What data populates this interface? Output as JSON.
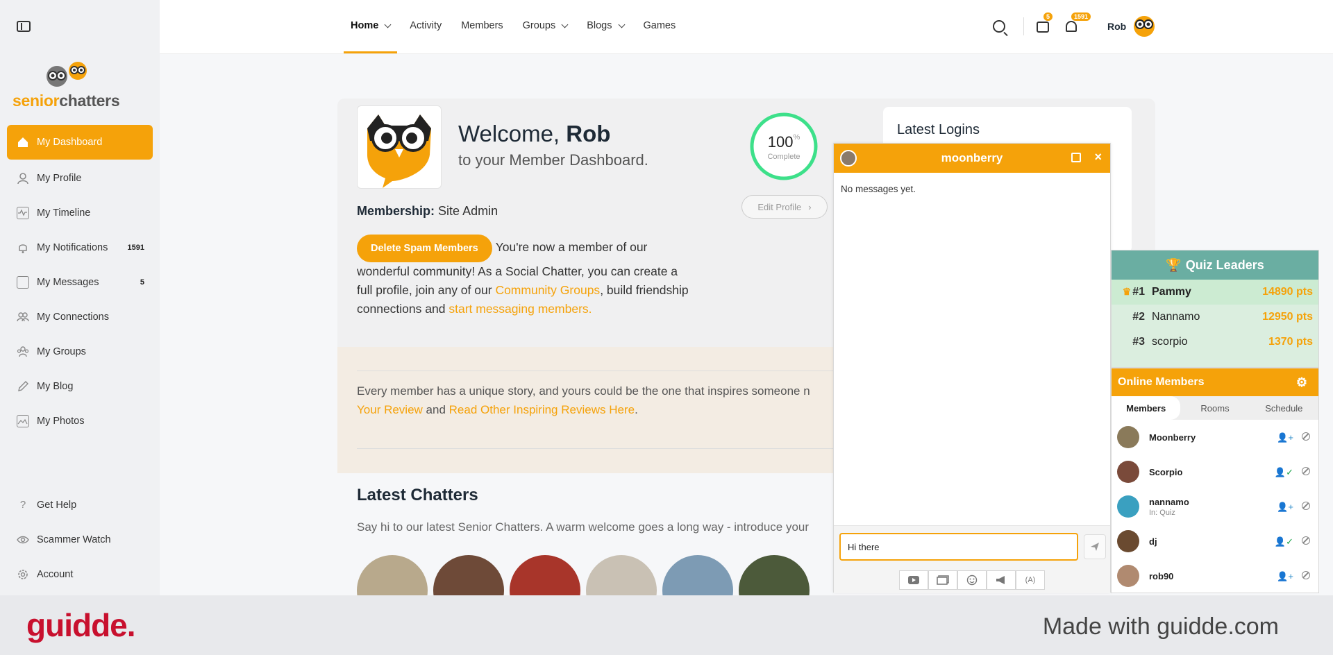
{
  "sidebar": {
    "logo": {
      "senior": "senior",
      "chatters": "chatters"
    },
    "items": [
      {
        "label": "My Dashboard",
        "icon": "home-icon",
        "active": true
      },
      {
        "label": "My Profile",
        "icon": "user-icon"
      },
      {
        "label": "My Timeline",
        "icon": "activity-icon"
      },
      {
        "label": "My Notifications",
        "icon": "bell-icon",
        "badge": "1591"
      },
      {
        "label": "My Messages",
        "icon": "inbox-icon",
        "badge": "5"
      },
      {
        "label": "My Connections",
        "icon": "users-icon"
      },
      {
        "label": "My Groups",
        "icon": "groups-icon"
      },
      {
        "label": "My Blog",
        "icon": "pencil-icon"
      },
      {
        "label": "My Photos",
        "icon": "photos-icon"
      }
    ],
    "bottom": [
      {
        "label": "Get Help",
        "icon": "question-icon"
      },
      {
        "label": "Scammer Watch",
        "icon": "eye-icon"
      },
      {
        "label": "Account",
        "icon": "gear-icon"
      }
    ]
  },
  "topnav": {
    "menu": [
      {
        "label": "Home",
        "active": true,
        "dropdown": true
      },
      {
        "label": "Activity"
      },
      {
        "label": "Members"
      },
      {
        "label": "Groups",
        "dropdown": true
      },
      {
        "label": "Blogs",
        "dropdown": true
      },
      {
        "label": "Games"
      }
    ],
    "messages_badge": "5",
    "notifications_badge": "1591",
    "user_name": "Rob"
  },
  "dashboard": {
    "welcome_prefix": "Welcome,",
    "welcome_name": "Rob",
    "subtitle": "to your Member Dashboard.",
    "progress_value": "100",
    "progress_unit": "%",
    "progress_label": "Complete",
    "edit_profile": "Edit Profile",
    "membership_label": "Membership:",
    "membership_value": "Site Admin",
    "spam_button": "Delete Spam Members",
    "intro_1": "You're now a member of our wonderful community! As a Social Chatter, you can create a full profile, join any of our",
    "intro_link_1": "Community Groups",
    "intro_2": ", build friendship connections and",
    "intro_link_2": "start messaging members.",
    "review_text": "Every member has a unique story, and yours could be the one that inspires someone n",
    "review_link_1": "Your Review",
    "review_and": "and",
    "review_link_2": "Read Other Inspiring Reviews Here",
    "latest_chatters_title": "Latest Chatters",
    "latest_chatters_sub": "Say hi to our latest Senior Chatters. A warm welcome goes a long way - introduce your",
    "latest_logins_title": "Latest Logins"
  },
  "chat": {
    "title": "moonberry",
    "empty": "No messages yet.",
    "input_value": "Hi there"
  },
  "quiz": {
    "title": "Quiz Leaders",
    "leaders": [
      {
        "rank": "#1",
        "name": "Pammy",
        "points": "14890 pts"
      },
      {
        "rank": "#2",
        "name": "Nannamo",
        "points": "12950 pts"
      },
      {
        "rank": "#3",
        "name": "scorpio",
        "points": "1370 pts"
      }
    ]
  },
  "online": {
    "title": "Online Members",
    "tabs": [
      "Members",
      "Rooms",
      "Schedule"
    ],
    "members": [
      {
        "name": "Moonberry",
        "sub": ""
      },
      {
        "name": "Scorpio",
        "sub": ""
      },
      {
        "name": "nannamo",
        "sub": "In: Quiz"
      },
      {
        "name": "dj",
        "sub": ""
      },
      {
        "name": "rob90",
        "sub": ""
      }
    ]
  },
  "footer": {
    "logo": "guidde.",
    "made_with": "Made with guidde.com"
  },
  "colors": {
    "accent": "#f5a20a",
    "quiz_header": "#6aaea2",
    "progress_ring": "#3de08a",
    "footer_logo": "#c8102e"
  }
}
